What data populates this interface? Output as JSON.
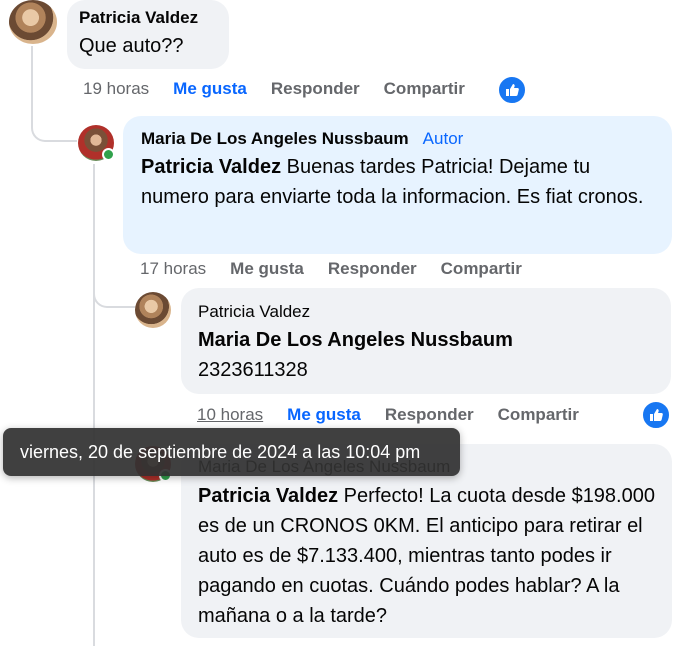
{
  "comments": [
    {
      "author": "Patricia Valdez",
      "text": "Que auto??",
      "time": "19 horas",
      "like": "Me gusta",
      "reply": "Responder",
      "share": "Compartir"
    },
    {
      "author": "Maria De Los Angeles Nussbaum",
      "badge": "Autor",
      "mention": "Patricia Valdez",
      "text": " Buenas tardes Patricia! Dejame tu numero para enviarte toda la informacion. Es fiat cronos.",
      "time": "17 horas",
      "like": "Me gusta",
      "reply": "Responder",
      "share": "Compartir"
    },
    {
      "author": "Patricia Valdez",
      "mention": "Maria De Los Angeles Nussbaum",
      "text": "2323611328",
      "time": "10 horas",
      "like": "Me gusta",
      "reply": "Responder",
      "share": "Compartir"
    },
    {
      "author": "Maria De Los Angeles Nussbaum",
      "mention": "Patricia Valdez",
      "text": " Perfecto! La cuota desde $198.000 es de un CRONOS 0KM. El anticipo para retirar el auto es de $7.133.400, mientras tanto podes ir pagando en cuotas. Cuándo podes hablar? A la mañana o a la tarde?"
    }
  ],
  "tooltip": "viernes, 20 de septiembre de 2024 a las 10:04 pm",
  "colors": {
    "accent": "#0866ff",
    "bubble_grey": "#f0f2f5",
    "bubble_blue": "#e7f3ff",
    "muted": "#65676b",
    "online": "#31a24c"
  },
  "icons": [
    "thumbs-up-icon",
    "online-status-icon"
  ]
}
